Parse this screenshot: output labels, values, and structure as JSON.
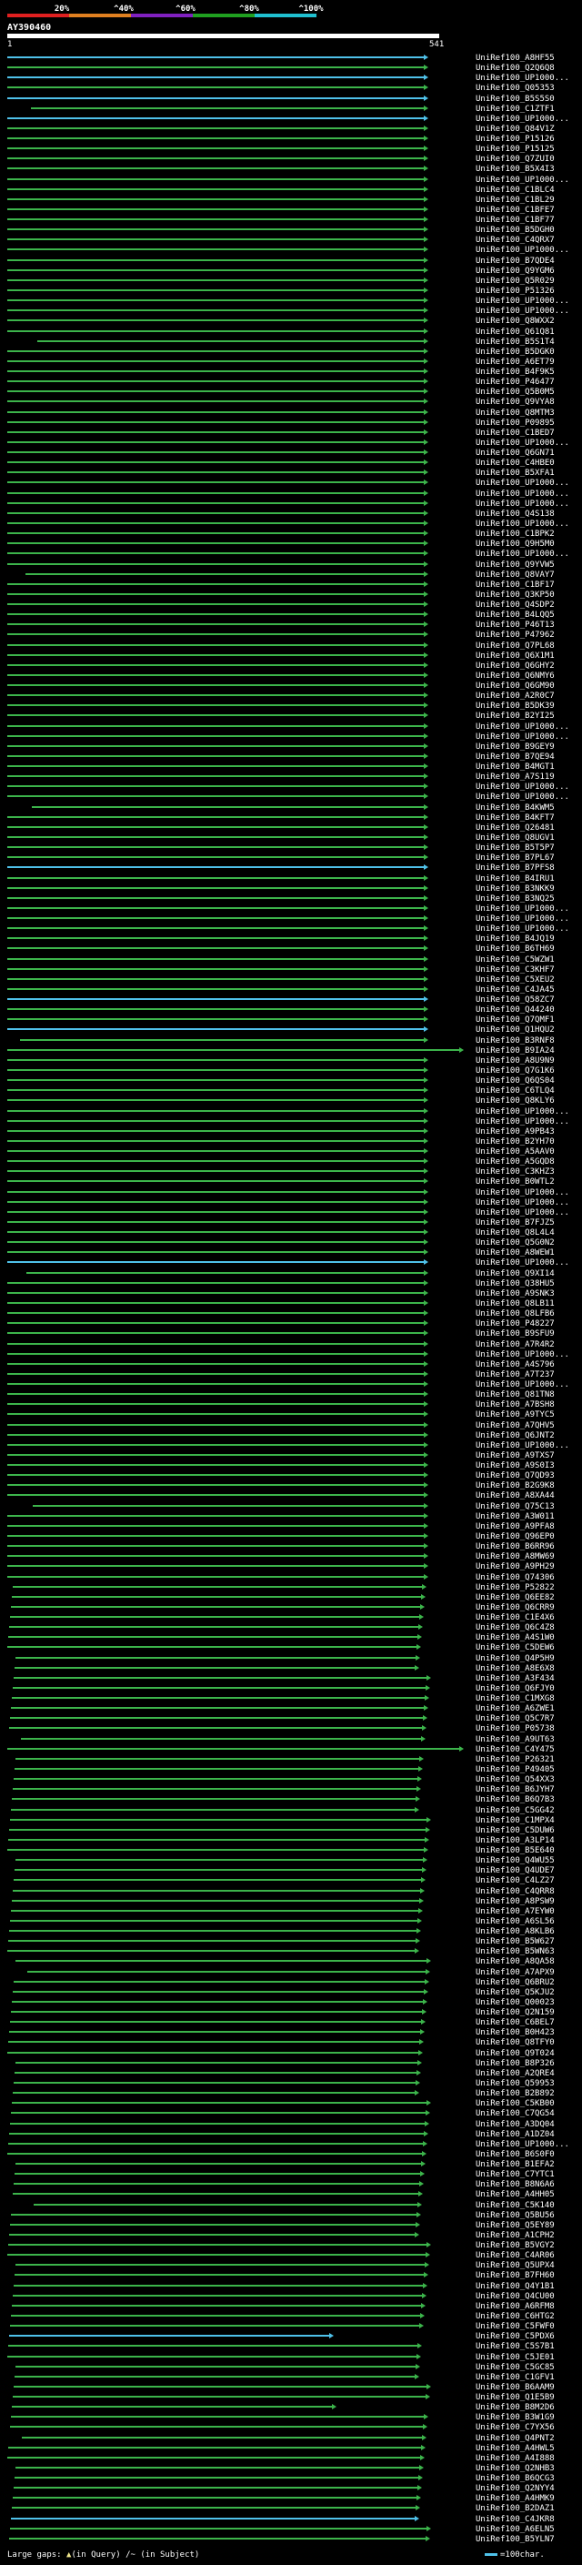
{
  "scale": {
    "labels": [
      "20%",
      "^40%",
      "^60%",
      "^80%",
      "^100%"
    ],
    "colors": [
      "#e02020",
      "#e08020",
      "#8020c0",
      "#20a020",
      "#20c0d0"
    ]
  },
  "query": {
    "name": "AY390460",
    "start": "1",
    "end": "541"
  },
  "colors": {
    "green_hit": "#3cb44b",
    "cyan_hit": "#4fc1e9",
    "background": "#000000",
    "text": "#ffffff"
  },
  "hits": [
    "UniRef100_A8HF55",
    "UniRef100_Q2Q6Q8",
    "UniRef100_UP1000...",
    "UniRef100_Q05353",
    "UniRef100_B5S5S0",
    "UniRef100_C1ZTF1",
    "UniRef100_UP1000...",
    "UniRef100_Q84V1Z",
    "UniRef100_P15126",
    "UniRef100_P15125",
    "UniRef100_Q7ZUI0",
    "UniRef100_B5X4I3",
    "UniRef100_UP1000...",
    "UniRef100_C1BLC4",
    "UniRef100_C1BL29",
    "UniRef100_C1BFE7",
    "UniRef100_C1BF77",
    "UniRef100_B5DGH0",
    "UniRef100_C4QRX7",
    "UniRef100_UP1000...",
    "UniRef100_B7QDE4",
    "UniRef100_Q9YGM6",
    "UniRef100_Q5R029",
    "UniRef100_P51326",
    "UniRef100_UP1000...",
    "UniRef100_UP1000...",
    "UniRef100_Q8WXX2",
    "UniRef100_Q61Q81",
    "UniRef100_B5S1T4",
    "UniRef100_B5DGK0",
    "UniRef100_A6ET79",
    "UniRef100_B4F9K5",
    "UniRef100_P46477",
    "UniRef100_Q5B0M5",
    "UniRef100_Q9VYA8",
    "UniRef100_Q8MTM3",
    "UniRef100_P09895",
    "UniRef100_C1BED7",
    "UniRef100_UP1000...",
    "UniRef100_Q6GN71",
    "UniRef100_C4HBE0",
    "UniRef100_B5XFA1",
    "UniRef100_UP1000...",
    "UniRef100_UP1000...",
    "UniRef100_UP1000...",
    "UniRef100_Q4S138",
    "UniRef100_UP1000...",
    "UniRef100_C1BPK2",
    "UniRef100_Q9H5M0",
    "UniRef100_UP1000...",
    "UniRef100_Q9YVW5",
    "UniRef100_Q8VAY7",
    "UniRef100_C1BF17",
    "UniRef100_Q3KP50",
    "UniRef100_Q4SDP2",
    "UniRef100_B4LQQ5",
    "UniRef100_P46T13",
    "UniRef100_P47962",
    "UniRef100_Q7PL68",
    "UniRef100_Q6X1M1",
    "UniRef100_Q6GHY2",
    "UniRef100_Q6NMY6",
    "UniRef100_Q6GM90",
    "UniRef100_A2R0C7",
    "UniRef100_B5DK39",
    "UniRef100_B2YI25",
    "UniRef100_UP1000...",
    "UniRef100_UP1000...",
    "UniRef100_B9GEY9",
    "UniRef100_B7QE94",
    "UniRef100_B4MGT1",
    "UniRef100_A7S119",
    "UniRef100_UP1000...",
    "UniRef100_UP1000...",
    "UniRef100_B4KWM5",
    "UniRef100_B4KFT7",
    "UniRef100_Q26481",
    "UniRef100_Q8UGV1",
    "UniRef100_B5T5P7",
    "UniRef100_B7PL67",
    "UniRef100_B7PFS8",
    "UniRef100_B4IRU1",
    "UniRef100_B3NKK9",
    "UniRef100_B3NQ25",
    "UniRef100_UP1000...",
    "UniRef100_UP1000...",
    "UniRef100_UP1000...",
    "UniRef100_B4JQ19",
    "UniRef100_B6TH69",
    "UniRef100_C5WZW1",
    "UniRef100_C3KHF7",
    "UniRef100_C5XEU2",
    "UniRef100_C4JA45",
    "UniRef100_Q58ZC7",
    "UniRef100_Q44240",
    "UniRef100_Q7QMF1",
    "UniRef100_Q1HQU2",
    "UniRef100_B3RNF8",
    "UniRef100_B9IA24",
    "UniRef100_A8U9N9",
    "UniRef100_Q7G1K6",
    "UniRef100_Q6QS04",
    "UniRef100_C6TLQ4",
    "UniRef100_Q8KLY6",
    "UniRef100_UP1000...",
    "UniRef100_UP1000...",
    "UniRef100_A9PB43",
    "UniRef100_B2YH70",
    "UniRef100_A5AAV0",
    "UniRef100_A5GQD8",
    "UniRef100_C3KHZ3",
    "UniRef100_B0WTL2",
    "UniRef100_UP1000...",
    "UniRef100_UP1000...",
    "UniRef100_UP1000...",
    "UniRef100_B7FJZ5",
    "UniRef100_Q8L4L4",
    "UniRef100_Q5G0N2",
    "UniRef100_A8WEW1",
    "UniRef100_UP1000...",
    "UniRef100_Q9XI14",
    "UniRef100_Q38HU5",
    "UniRef100_A9SNK3",
    "UniRef100_Q8LB11",
    "UniRef100_Q8LFB6",
    "UniRef100_P48227",
    "UniRef100_B9SFU9",
    "UniRef100_A7R4R2",
    "UniRef100_UP1000...",
    "UniRef100_A4S796",
    "UniRef100_A7T237",
    "UniRef100_UP1000...",
    "UniRef100_Q81TN8",
    "UniRef100_A7BSH8",
    "UniRef100_A9TYC5",
    "UniRef100_A7QHV5",
    "UniRef100_Q6JNT2",
    "UniRef100_UP1000...",
    "UniRef100_A9TXS7",
    "UniRef100_A9S0I3",
    "UniRef100_Q7QD93",
    "UniRef100_B2G9K8",
    "UniRef100_A8XA44",
    "UniRef100_Q75C13",
    "UniRef100_A3W011",
    "UniRef100_A9PFA8",
    "UniRef100_Q96EP0",
    "UniRef100_B6RR96",
    "UniRef100_A8MW69",
    "UniRef100_A9PH29",
    "UniRef100_Q74306",
    "UniRef100_P52822",
    "UniRef100_Q6EE82",
    "UniRef100_Q6CRR9",
    "UniRef100_C1E4X6",
    "UniRef100_Q6C4Z8",
    "UniRef100_A4S1W0",
    "UniRef100_C5DEW6",
    "UniRef100_Q4P5H9",
    "UniRef100_A8E6X8",
    "UniRef100_A3F434",
    "UniRef100_Q6FJY0",
    "UniRef100_C1MXG8",
    "UniRef100_A6ZWE1",
    "UniRef100_Q5C7R7",
    "UniRef100_P05738",
    "UniRef100_A9UT63",
    "UniRef100_C4Y475",
    "UniRef100_P26321",
    "UniRef100_P49405",
    "UniRef100_Q54XX3",
    "UniRef100_B6JYH7",
    "UniRef100_B6Q7B3",
    "UniRef100_C5GG42",
    "UniRef100_C1MPX4",
    "UniRef100_C5DUW6",
    "UniRef100_A3LP14",
    "UniRef100_B5E640",
    "UniRef100_Q4WU55",
    "UniRef100_Q4UDE7",
    "UniRef100_C4LZ27",
    "UniRef100_C4QRR8",
    "UniRef100_A8PSW9",
    "UniRef100_A7EYW0",
    "UniRef100_A6SL56",
    "UniRef100_A8KLB6",
    "UniRef100_B5W627",
    "UniRef100_B5WN63",
    "UniRef100_A8QA58",
    "UniRef100_A7APX9",
    "UniRef100_Q6BRU2",
    "UniRef100_Q5KJU2",
    "UniRef100_Q00023",
    "UniRef100_Q2N159",
    "UniRef100_C6BEL7",
    "UniRef100_B0H423",
    "UniRef100_Q8TFY0",
    "UniRef100_Q9T024",
    "UniRef100_B8P326",
    "UniRef100_A2QRE4",
    "UniRef100_Q59953",
    "UniRef100_B2B892",
    "UniRef100_C5KB00",
    "UniRef100_C7QG54",
    "UniRef100_A3DQ04",
    "UniRef100_A1DZ04",
    "UniRef100_UP1000...",
    "UniRef100_B6S0F0",
    "UniRef100_B1EFA2",
    "UniRef100_C7YTC1",
    "UniRef100_B8N6A6",
    "UniRef100_A4HH05",
    "UniRef100_C5K140",
    "UniRef100_Q5BU56",
    "UniRef100_Q5EY89",
    "UniRef100_A1CPH2",
    "UniRef100_B5VGY2",
    "UniRef100_C4AR06",
    "UniRef100_Q5UPX4",
    "UniRef100_B7FH60",
    "UniRef100_Q4Y1B1",
    "UniRef100_Q4CU00",
    "UniRef100_A6RFM8",
    "UniRef100_C6HTG2",
    "UniRef100_C5FWF0",
    "UniRef100_C5PDX6",
    "UniRef100_C5S7B1",
    "UniRef100_C5JE01",
    "UniRef100_C5GC85",
    "UniRef100_C1GFV1",
    "UniRef100_B6AAM9",
    "UniRef100_Q1E5B9",
    "UniRef100_B8M2D6",
    "UniRef100_B3W1G9",
    "UniRef100_C7YX56",
    "UniRef100_Q4PNT2",
    "UniRef100_A4HWL5",
    "UniRef100_A4I888",
    "UniRef100_Q2NHB3",
    "UniRef100_B6QCG3",
    "UniRef100_Q2NYY4",
    "UniRef100_A4HMK9",
    "UniRef100_B2DAZ1",
    "UniRef100_C4JKR8",
    "UniRef100_A6ELN5",
    "UniRef100_B5YLN7"
  ],
  "legend": {
    "gaps_text": "Large gaps:",
    "query_gap_text": "(in Query)",
    "subject_gap_text": "/~ (in Subject)",
    "scale_text": "=100char."
  }
}
